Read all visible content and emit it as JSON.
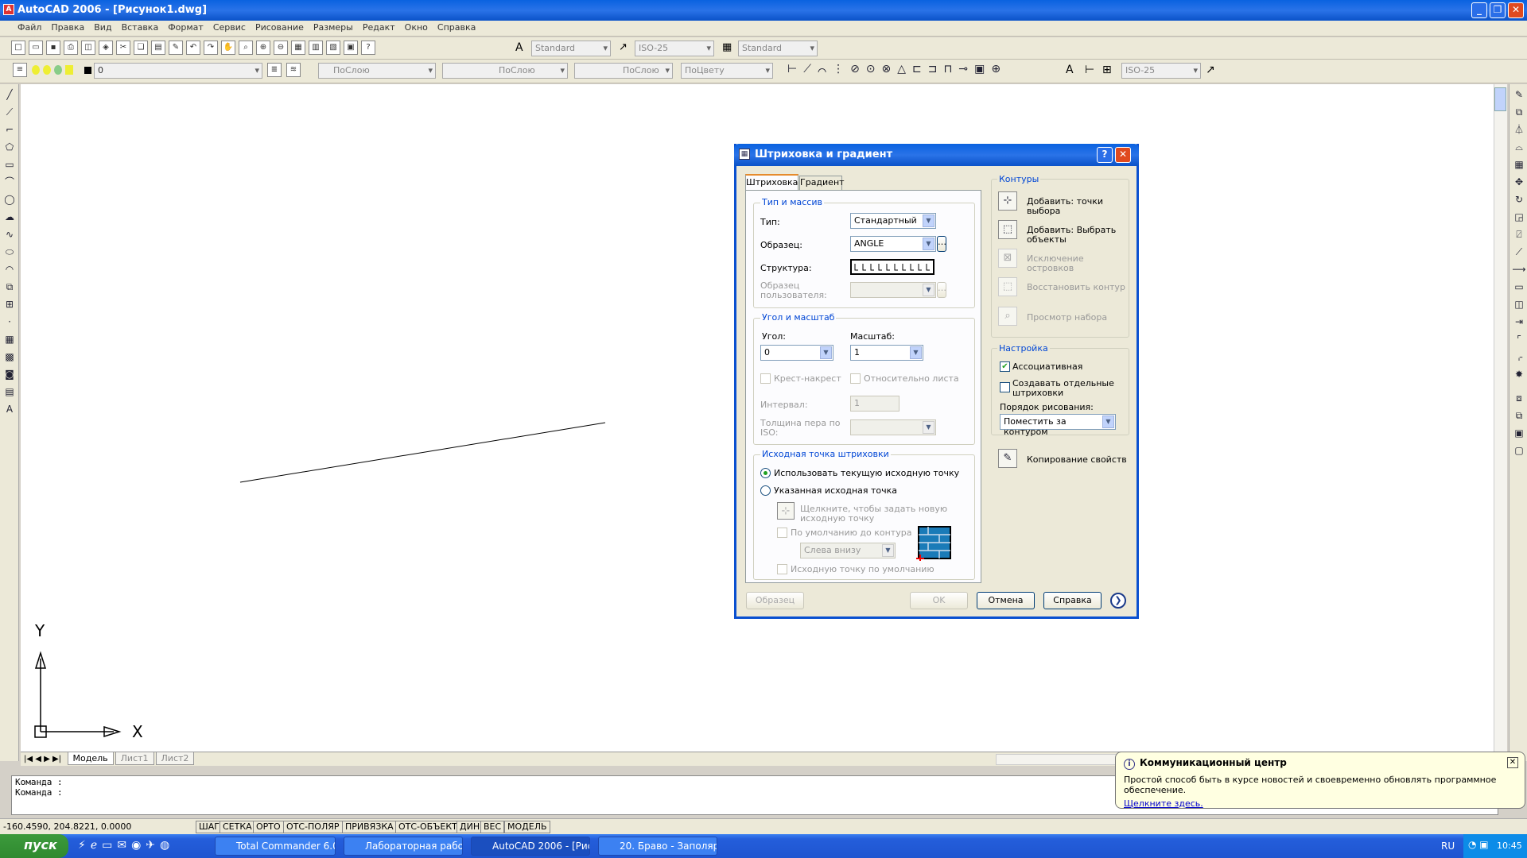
{
  "window": {
    "title": "AutoCAD 2006 - [Рисунок1.dwg]"
  },
  "menu": [
    "Файл",
    "Правка",
    "Вид",
    "Вставка",
    "Формат",
    "Сервис",
    "Рисование",
    "Размеры",
    "Редакт",
    "Окно",
    "Справка"
  ],
  "toolbar1": {
    "textstyle": "Standard",
    "dimstyle": "ISO-25",
    "tablestyle": "Standard"
  },
  "toolbar2": {
    "layer": "0",
    "color": "ПоСлою",
    "linetype": "ПоСлою",
    "lineweight": "ПоСлою",
    "plotstyle": "ПоЦвету",
    "dimstyle2": "ISO-25"
  },
  "ucs": {
    "x": "X",
    "y": "Y"
  },
  "tabs": [
    "Модель",
    "Лист1",
    "Лист2"
  ],
  "command": {
    "line1": "Команда :",
    "line2": "Команда :"
  },
  "status": {
    "coords": "-160.4590, 204.8221, 0.0000",
    "buttons": [
      "ШАГ",
      "СЕТКА",
      "ОРТО",
      "ОТС-ПОЛЯР",
      "ПРИВЯЗКА",
      "ОТС-ОБЪЕКТ",
      "ДИН",
      "ВЕС",
      "МОДЕЛЬ"
    ]
  },
  "taskbar": {
    "start": "пуск",
    "tasks": [
      "Total Commander 6.0...",
      "Лабораторная рабо...",
      "AutoCAD 2006 - [Рис...",
      "20. Браво - Заполяр..."
    ],
    "lang": "RU",
    "time": "10:45"
  },
  "notification": {
    "title": "Коммуникационный центр",
    "text": "Простой способ быть в курсе новостей и своевременно обновлять программное обеспечение.",
    "link": "Щелкните здесь."
  },
  "dialog": {
    "title": "Штриховка и градиент",
    "tabs": [
      "Штриховка",
      "Градиент"
    ],
    "type_group": "Тип и массив",
    "type_label": "Тип:",
    "type_value": "Стандартный",
    "pattern_label": "Образец:",
    "pattern_value": "ANGLE",
    "swatch_label": "Структура:",
    "custom_label1": "Образец",
    "custom_label2": "пользователя:",
    "angle_group": "Угол и масштаб",
    "angle_label": "Угол:",
    "angle_value": "0",
    "scale_label": "Масштаб:",
    "scale_value": "1",
    "double_label": "Крест-накрест",
    "relative_label": "Относительно листа",
    "spacing_label": "Интервал:",
    "spacing_value": "1",
    "isopen_label1": "Толщина пера по",
    "isopen_label2": "ISO:",
    "origin_group": "Исходная точка штриховки",
    "origin_current": "Использовать текущую исходную точку",
    "origin_specified": "Указанная исходная точка",
    "click_origin1": "Щелкните, чтобы задать новую",
    "click_origin2": "исходную точку",
    "default_extents": "По умолчанию до контура",
    "extents_value": "Слева внизу",
    "store_default": "Исходную точку по умолчанию",
    "boundaries_group": "Контуры",
    "add_pick1": "Добавить: точки",
    "add_pick2": "выбора",
    "add_select1": "Добавить: Выбрать",
    "add_select2": "объекты",
    "remove1": "Исключение",
    "remove2": "островков",
    "recreate": "Восстановить контур",
    "view_sel": "Просмотр набора",
    "options_group": "Настройка",
    "associative": "Ассоциативная",
    "separate1": "Создавать отдельные",
    "separate2": "штриховки",
    "draw_order_label": "Порядок рисования:",
    "draw_order_value": "Поместить за контуром",
    "inherit": "Копирование свойств",
    "btn_preview": "Образец",
    "btn_ok": "OK",
    "btn_cancel": "Отмена",
    "btn_help": "Справка"
  }
}
